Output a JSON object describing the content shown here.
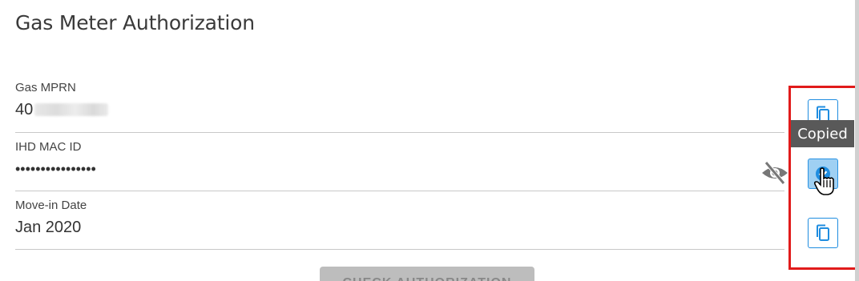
{
  "page": {
    "title": "Gas Meter Authorization"
  },
  "fields": {
    "mprn": {
      "label": "Gas MPRN",
      "value_visible": "40"
    },
    "mac": {
      "label": "IHD MAC ID",
      "value": "••••••••••••••••"
    },
    "move_in": {
      "label": "Move-in Date",
      "value": "Jan 2020"
    }
  },
  "actions": {
    "tooltip": "Copied",
    "check_button_label": "CHECK AUTHORIZATION"
  },
  "colors": {
    "accent": "#1f8de0",
    "highlight": "#e11b1b",
    "tooltip_bg": "#595959"
  },
  "icons": {
    "copy": "copy-icon",
    "check": "check-circle-icon",
    "visibility": "eye-off-icon",
    "cursor": "hand-pointer-icon"
  }
}
